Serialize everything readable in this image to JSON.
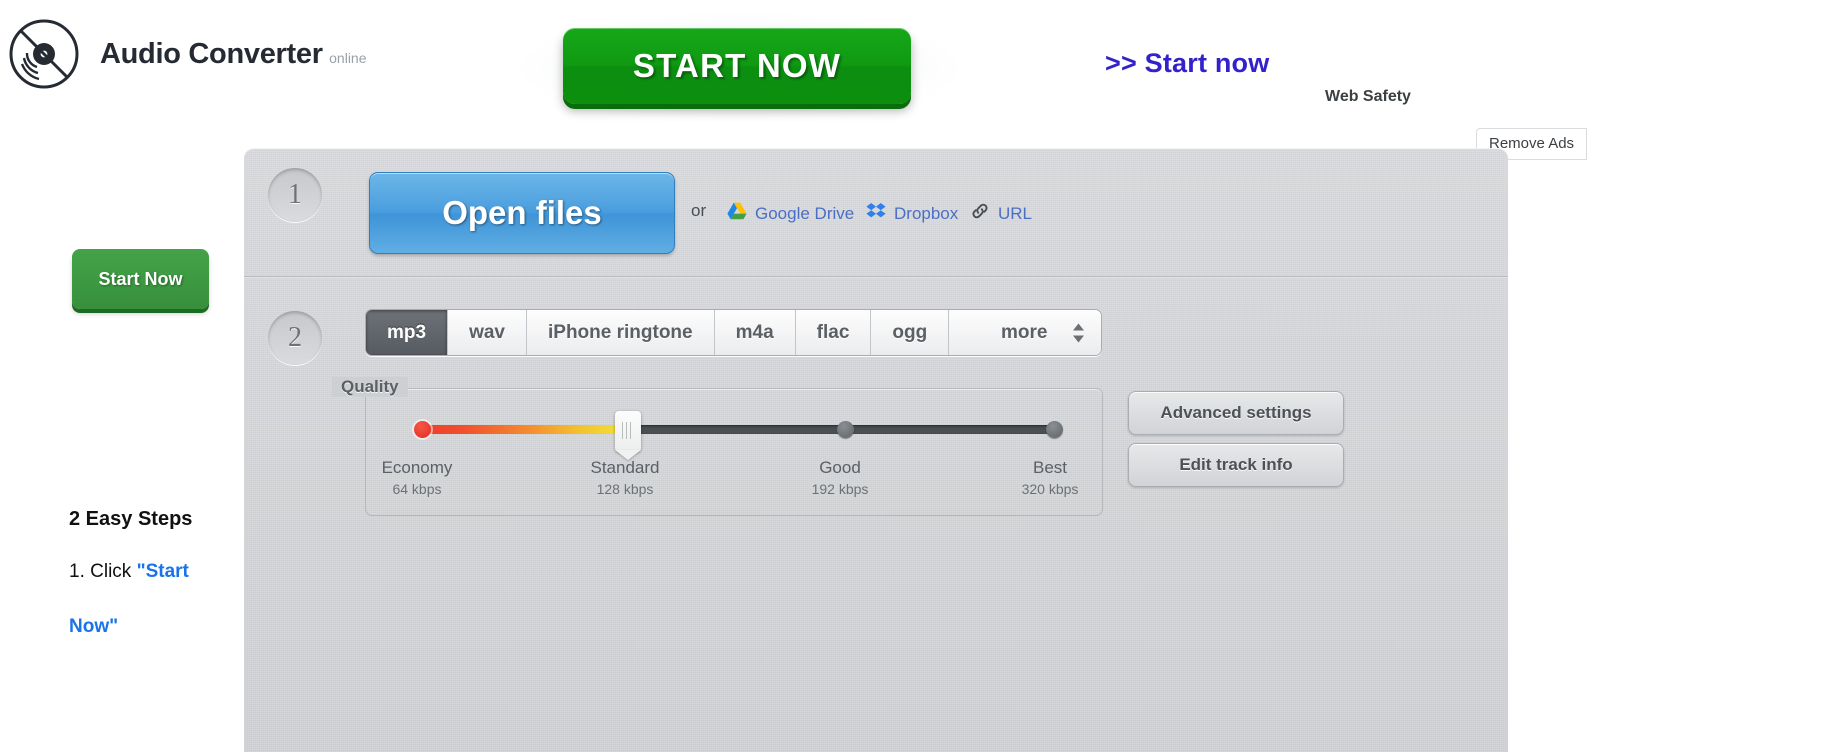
{
  "brand": {
    "title": "Audio Converter",
    "subtitle": "online",
    "logo_icon": "vinyl-record-icon"
  },
  "ads": {
    "start_now_button": "START NOW",
    "start_now_link": ">> Start now",
    "web_safety": "Web Safety",
    "remove_ads": "Remove Ads",
    "link_color": "#3322cc",
    "button_color": "#0f9a12"
  },
  "sidebar": {
    "start_now_button": "Start Now",
    "heading": "2 Easy Steps",
    "step1_prefix": "1. Click ",
    "step1_link": "\"Start",
    "step1_link_cont": "Now\"",
    "link_color": "#1a73e8"
  },
  "steps": {
    "one": "1",
    "two": "2"
  },
  "step1": {
    "open_files_label": "Open files",
    "or_label": "or",
    "sources": [
      {
        "label": "Google Drive",
        "icon": "google-drive-icon"
      },
      {
        "label": "Dropbox",
        "icon": "dropbox-icon"
      },
      {
        "label": "URL",
        "icon": "link-chain-icon"
      }
    ]
  },
  "step2": {
    "format_tabs": [
      {
        "label": "mp3",
        "active": true
      },
      {
        "label": "wav",
        "active": false
      },
      {
        "label": "iPhone ringtone",
        "active": false
      },
      {
        "label": "m4a",
        "active": false
      },
      {
        "label": "flac",
        "active": false
      },
      {
        "label": "ogg",
        "active": false
      },
      {
        "label": "more",
        "active": false,
        "icon": "updown-arrows-icon"
      }
    ],
    "quality": {
      "legend": "Quality",
      "selected": "Standard",
      "stops": [
        {
          "name": "Economy",
          "bitrate": "64 kbps"
        },
        {
          "name": "Standard",
          "bitrate": "128 kbps"
        },
        {
          "name": "Good",
          "bitrate": "192 kbps"
        },
        {
          "name": "Best",
          "bitrate": "320 kbps"
        }
      ]
    },
    "buttons": {
      "advanced_settings": "Advanced settings",
      "edit_track_info": "Edit track info"
    }
  }
}
